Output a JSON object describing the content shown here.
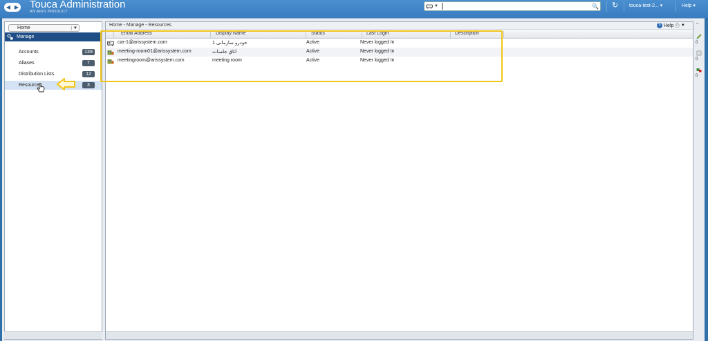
{
  "header": {
    "title": "Touca Administration",
    "subtitle": "AN ARIS PRODUCT",
    "search_placeholder": "",
    "user": "touca-test-2...",
    "help": "Help"
  },
  "sidebar": {
    "home_select": "Home",
    "section": "Manage",
    "items": [
      {
        "label": "Accounts",
        "count": "139"
      },
      {
        "label": "Aliases",
        "count": "7"
      },
      {
        "label": "Distribution Lists",
        "count": "12"
      },
      {
        "label": "Resources",
        "count": "3"
      }
    ]
  },
  "content": {
    "breadcrumb": "Home - Manage - Resources",
    "help": "Help",
    "columns": [
      "Email Address",
      "Display Name",
      "Status",
      "Last Login",
      "Description"
    ],
    "rows": [
      {
        "email": "car-1@arissystem.com",
        "display_name": "خودرو سازمانی 1",
        "status": "Active",
        "last_login": "Never logged In",
        "description": "",
        "icon": "vehicle-icon"
      },
      {
        "email": "meeting-room01@arissystem.com",
        "display_name": "اتاق جلسات",
        "status": "Active",
        "last_login": "Never logged In",
        "description": "",
        "icon": "room-icon"
      },
      {
        "email": "meetingroom@arissystem.com",
        "display_name": "meeting room",
        "status": "Active",
        "last_login": "Never logged In",
        "description": "",
        "icon": "room-icon"
      }
    ]
  },
  "side_tools": [
    "0",
    "0",
    "0"
  ],
  "colors": {
    "banner": "#3a7cc0",
    "nav_header": "#1e4e85",
    "highlight": "#f2c418",
    "badge": "#4b5c6c"
  }
}
